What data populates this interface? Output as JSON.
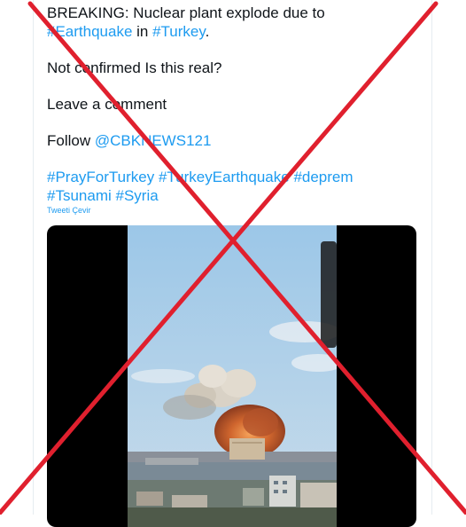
{
  "tweet": {
    "line1": "BREAKING: Nuclear plant explode due to",
    "line2_tag1": "#Earthquake",
    "line2_mid": " in ",
    "line2_tag2": "#Turkey",
    "line2_end": ".",
    "line3": "Not confirmed Is this real?",
    "line4": "Leave a comment",
    "follow_label": "Follow ",
    "mention": "@CBKNEWS121",
    "hashtags_line1": [
      "#PrayForTurkey",
      "#TurkeyEarthquake",
      "#deprem"
    ],
    "hashtags_line2": [
      "#Tsunami",
      "#Syria"
    ],
    "translate_label": "Tweeti Çevir"
  },
  "colors": {
    "link": "#1d9bf0",
    "text": "#0f1419",
    "cross": "#e0202e"
  },
  "media": {
    "type": "video-frame",
    "description_icon": "explosion-video"
  }
}
